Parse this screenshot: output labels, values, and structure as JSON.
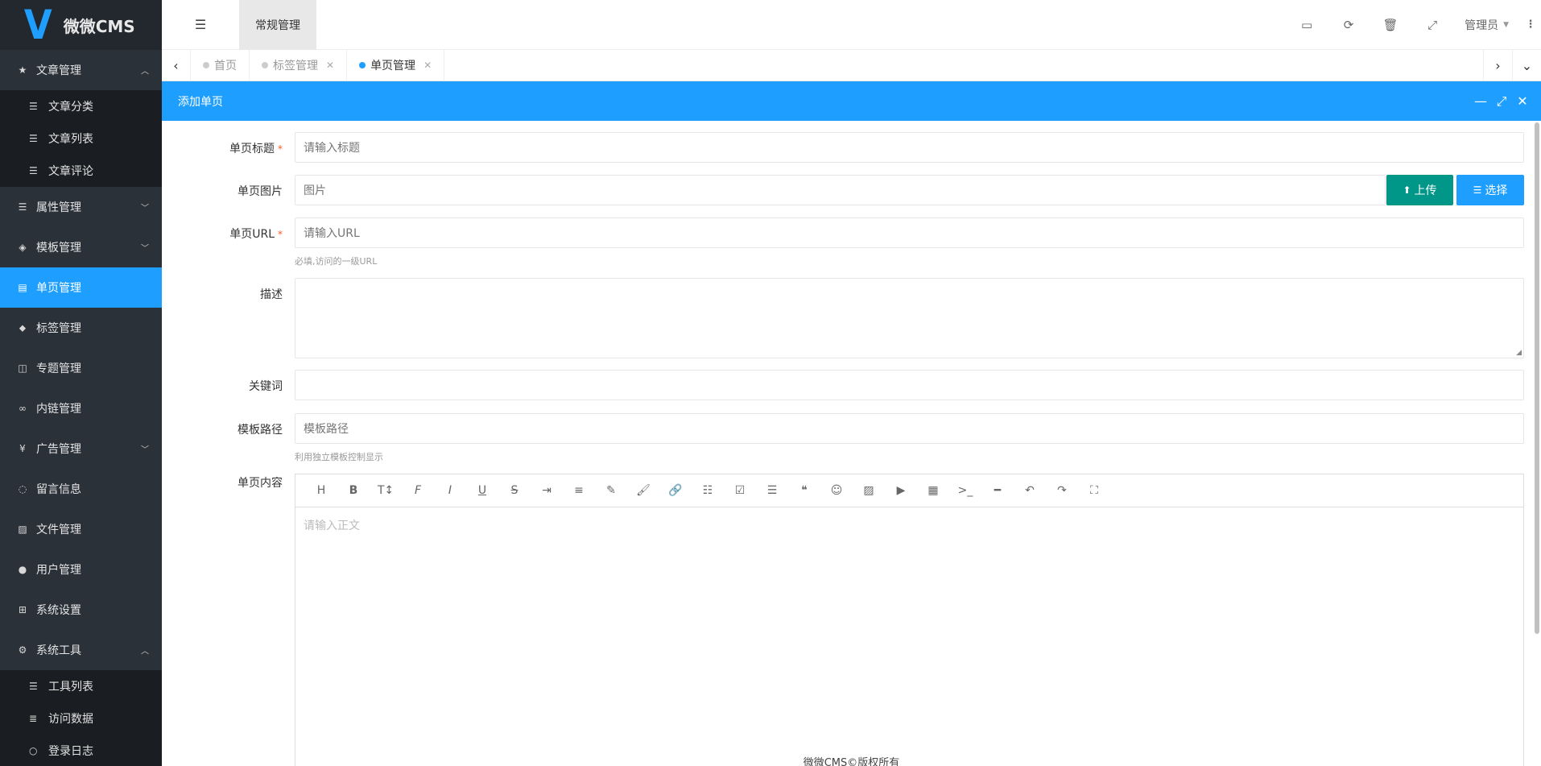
{
  "brand": {
    "logo_letter": "V",
    "name": "微微CMS"
  },
  "sidebar": {
    "items": [
      {
        "label": "文章管理",
        "icon": "star-icon",
        "expanded": true,
        "children": [
          {
            "label": "文章分类"
          },
          {
            "label": "文章列表"
          },
          {
            "label": "文章评论"
          }
        ]
      },
      {
        "label": "属性管理",
        "icon": "list-icon"
      },
      {
        "label": "模板管理",
        "icon": "cube-icon"
      },
      {
        "label": "单页管理",
        "icon": "page-icon",
        "active": true
      },
      {
        "label": "标签管理",
        "icon": "tag-icon"
      },
      {
        "label": "专题管理",
        "icon": "columns-icon"
      },
      {
        "label": "内链管理",
        "icon": "link-icon"
      },
      {
        "label": "广告管理",
        "icon": "yen-icon"
      },
      {
        "label": "留言信息",
        "icon": "comment-icon"
      },
      {
        "label": "文件管理",
        "icon": "image-icon"
      },
      {
        "label": "用户管理",
        "icon": "user-icon"
      },
      {
        "label": "系统设置",
        "icon": "windows-icon"
      },
      {
        "label": "系统工具",
        "icon": "gears-icon",
        "expanded": true,
        "children": [
          {
            "label": "工具列表"
          },
          {
            "label": "访问数据"
          },
          {
            "label": "登录日志"
          }
        ]
      }
    ]
  },
  "header": {
    "tab": "常规管理",
    "user": "管理员"
  },
  "tabs": [
    {
      "label": "首页"
    },
    {
      "label": "标签管理"
    },
    {
      "label": "单页管理",
      "active": true
    }
  ],
  "dialog": {
    "title": "添加单页",
    "fields": {
      "title": {
        "label": "单页标题",
        "placeholder": "请输入标题",
        "required": "*"
      },
      "image": {
        "label": "单页图片",
        "placeholder": "图片",
        "upload": "上传",
        "choose": "选择"
      },
      "url": {
        "label": "单页URL",
        "placeholder": "请输入URL",
        "required": "*",
        "hint": "必填,访问的一级URL"
      },
      "desc": {
        "label": "描述"
      },
      "keywords": {
        "label": "关键词"
      },
      "template": {
        "label": "模板路径",
        "placeholder": "模板路径",
        "hint": "利用独立模板控制显示"
      },
      "content": {
        "label": "单页内容",
        "placeholder": "请输入正文"
      }
    }
  },
  "footer": {
    "text": "微微CMS©版权所有"
  },
  "colors": {
    "primary": "#1e9fff",
    "green": "#009688",
    "sidebar": "#2b3139"
  }
}
